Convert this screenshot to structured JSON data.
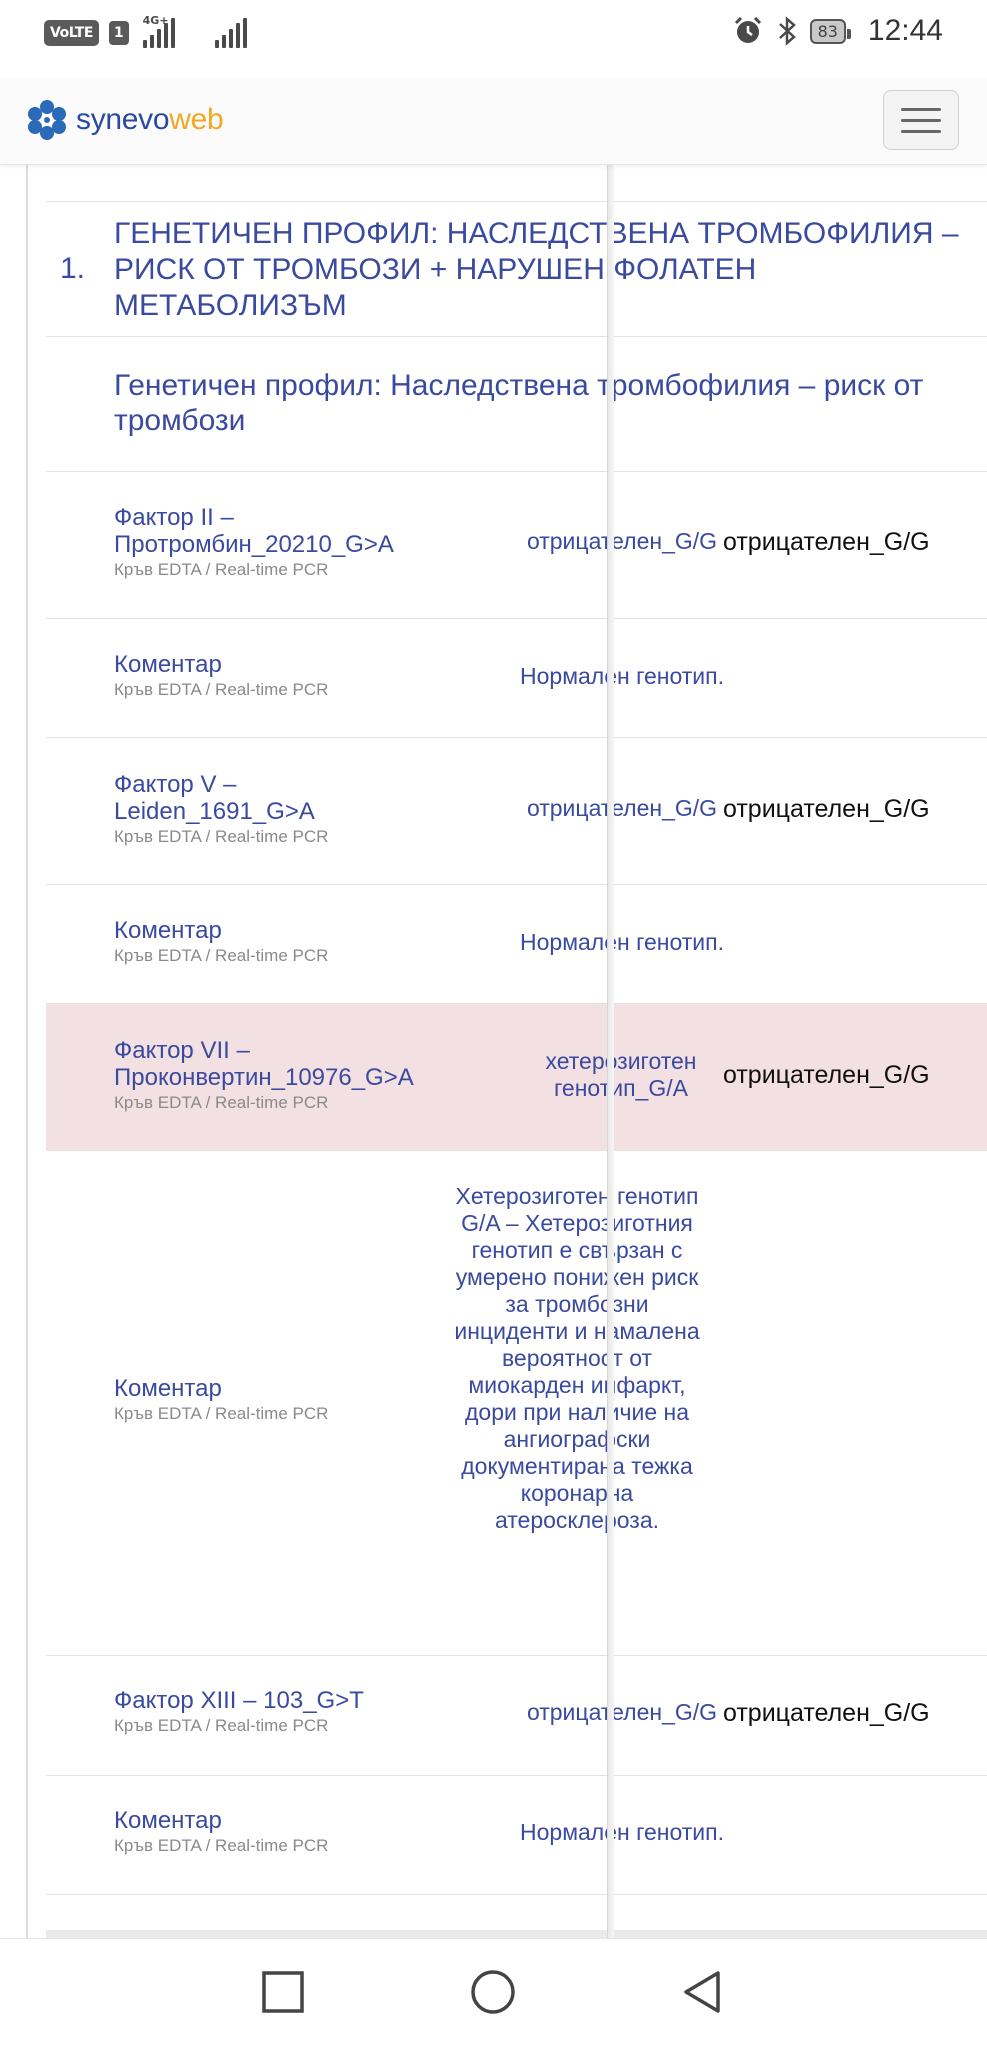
{
  "status_bar": {
    "volte": "VoLTE",
    "sim": "1",
    "network": "4G+",
    "battery": "83",
    "time": "12:44"
  },
  "nav": {
    "logo_part1": "synevo",
    "logo_part2": "web"
  },
  "profile": {
    "number": "1.",
    "title": "ГЕНЕТИЧЕН ПРОФИЛ: НАСЛЕДСТВЕНА ТРОМБОФИЛИЯ – РИСК ОТ ТРОМБОЗИ + НАРУШЕН ФОЛАТЕН МЕТАБОЛИЗЪМ",
    "subtitle": "Генетичен профил: Наследствена тромбофилия – риск от тромбози"
  },
  "rows": [
    {
      "name": "Фактор II – Протромбин_20210_G>A",
      "sample": "Кръв EDTA / Real-time PCR",
      "result": "отрицателен_G/G",
      "reference": "отрицателен_G/G",
      "highlight": false
    },
    {
      "name": "Коментар",
      "sample": "Кръв EDTA / Real-time PCR",
      "result": "Нормален генотип.",
      "reference": "",
      "highlight": false
    },
    {
      "name": "Фактор V – Leiden_1691_G>A",
      "sample": "Кръв EDTA / Real-time PCR",
      "result": "отрицателен_G/G",
      "reference": "отрицателен_G/G",
      "highlight": false
    },
    {
      "name": "Коментар",
      "sample": "Кръв EDTA / Real-time PCR",
      "result": "Нормален генотип.",
      "reference": "",
      "highlight": false
    },
    {
      "name": "Фактор VII – Проконвертин_10976_G>A",
      "sample": "Кръв EDTA / Real-time PCR",
      "result": "хетерозиготен генотип_G/A",
      "reference": "отрицателен_G/G",
      "highlight": true
    },
    {
      "name": "Коментар",
      "sample": "Кръв EDTA / Real-time PCR",
      "result": "Хетерозиготен генотип G/A – Хетерозиготния генотип е свързан с умерено понижен риск за тромбозни инциденти и намалена вероятност от миокарден инфаркт, дори при наличие на ангиографски документирана тежка коронарна атеросклероза.",
      "reference": "",
      "highlight": false
    },
    {
      "name": "Фактор XIII – 103_G>T",
      "sample": "Кръв EDTA / Real-time PCR",
      "result": "отрицателен_G/G",
      "reference": "отрицателен_G/G",
      "highlight": false
    },
    {
      "name": "Коментар",
      "sample": "Кръв EDTA / Real-time PCR",
      "result": "Нормален генотип.",
      "reference": "",
      "highlight": false
    }
  ],
  "colors": {
    "primary": "#3a4a9f",
    "highlight_bg": "#f3e0e2",
    "logo_orange": "#f5a623"
  }
}
